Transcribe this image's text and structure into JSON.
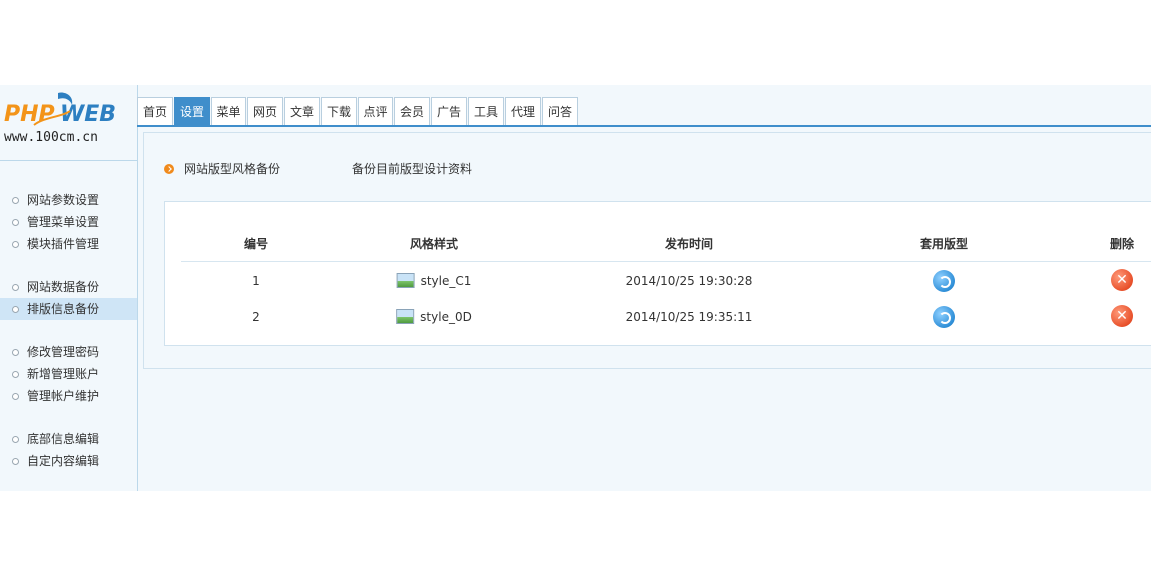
{
  "logo": {
    "brand_text": "PHPWEB",
    "url_text": "www.100cm.cn"
  },
  "tabs": [
    "首页",
    "设置",
    "菜单",
    "网页",
    "文章",
    "下载",
    "点评",
    "会员",
    "广告",
    "工具",
    "代理",
    "问答"
  ],
  "active_tab": "设置",
  "sidebar": {
    "groups": [
      [
        "网站参数设置",
        "管理菜单设置",
        "模块插件管理"
      ],
      [
        "网站数据备份",
        "排版信息备份"
      ],
      [
        "修改管理密码",
        "新增管理账户",
        "管理帐户维护"
      ],
      [
        "底部信息编辑",
        "自定内容编辑"
      ]
    ],
    "active_item": "排版信息备份"
  },
  "main": {
    "section_title": "网站版型风格备份",
    "section_desc": "备份目前版型设计资料",
    "table": {
      "headers": [
        "编号",
        "风格样式",
        "发布时间",
        "套用版型",
        "删除"
      ],
      "rows": [
        {
          "id": "1",
          "style": "style_C1",
          "time": "2014/10/25 19:30:28"
        },
        {
          "id": "2",
          "style": "style_0D",
          "time": "2014/10/25 19:35:11"
        }
      ]
    }
  },
  "icons": {
    "apply": "refresh-icon",
    "delete": "delete-x-icon",
    "thumbnail": "image-thumbnail-icon",
    "bullet": "circle-bullet-icon",
    "section": "orange-arrow-icon"
  },
  "colors": {
    "accent": "#3f8ecb",
    "background": "#f2f8fc",
    "active_menu": "#cfe5f6",
    "delete": "#e8502a",
    "logo_orange": "#f39419",
    "logo_blue": "#2d7fc1"
  }
}
